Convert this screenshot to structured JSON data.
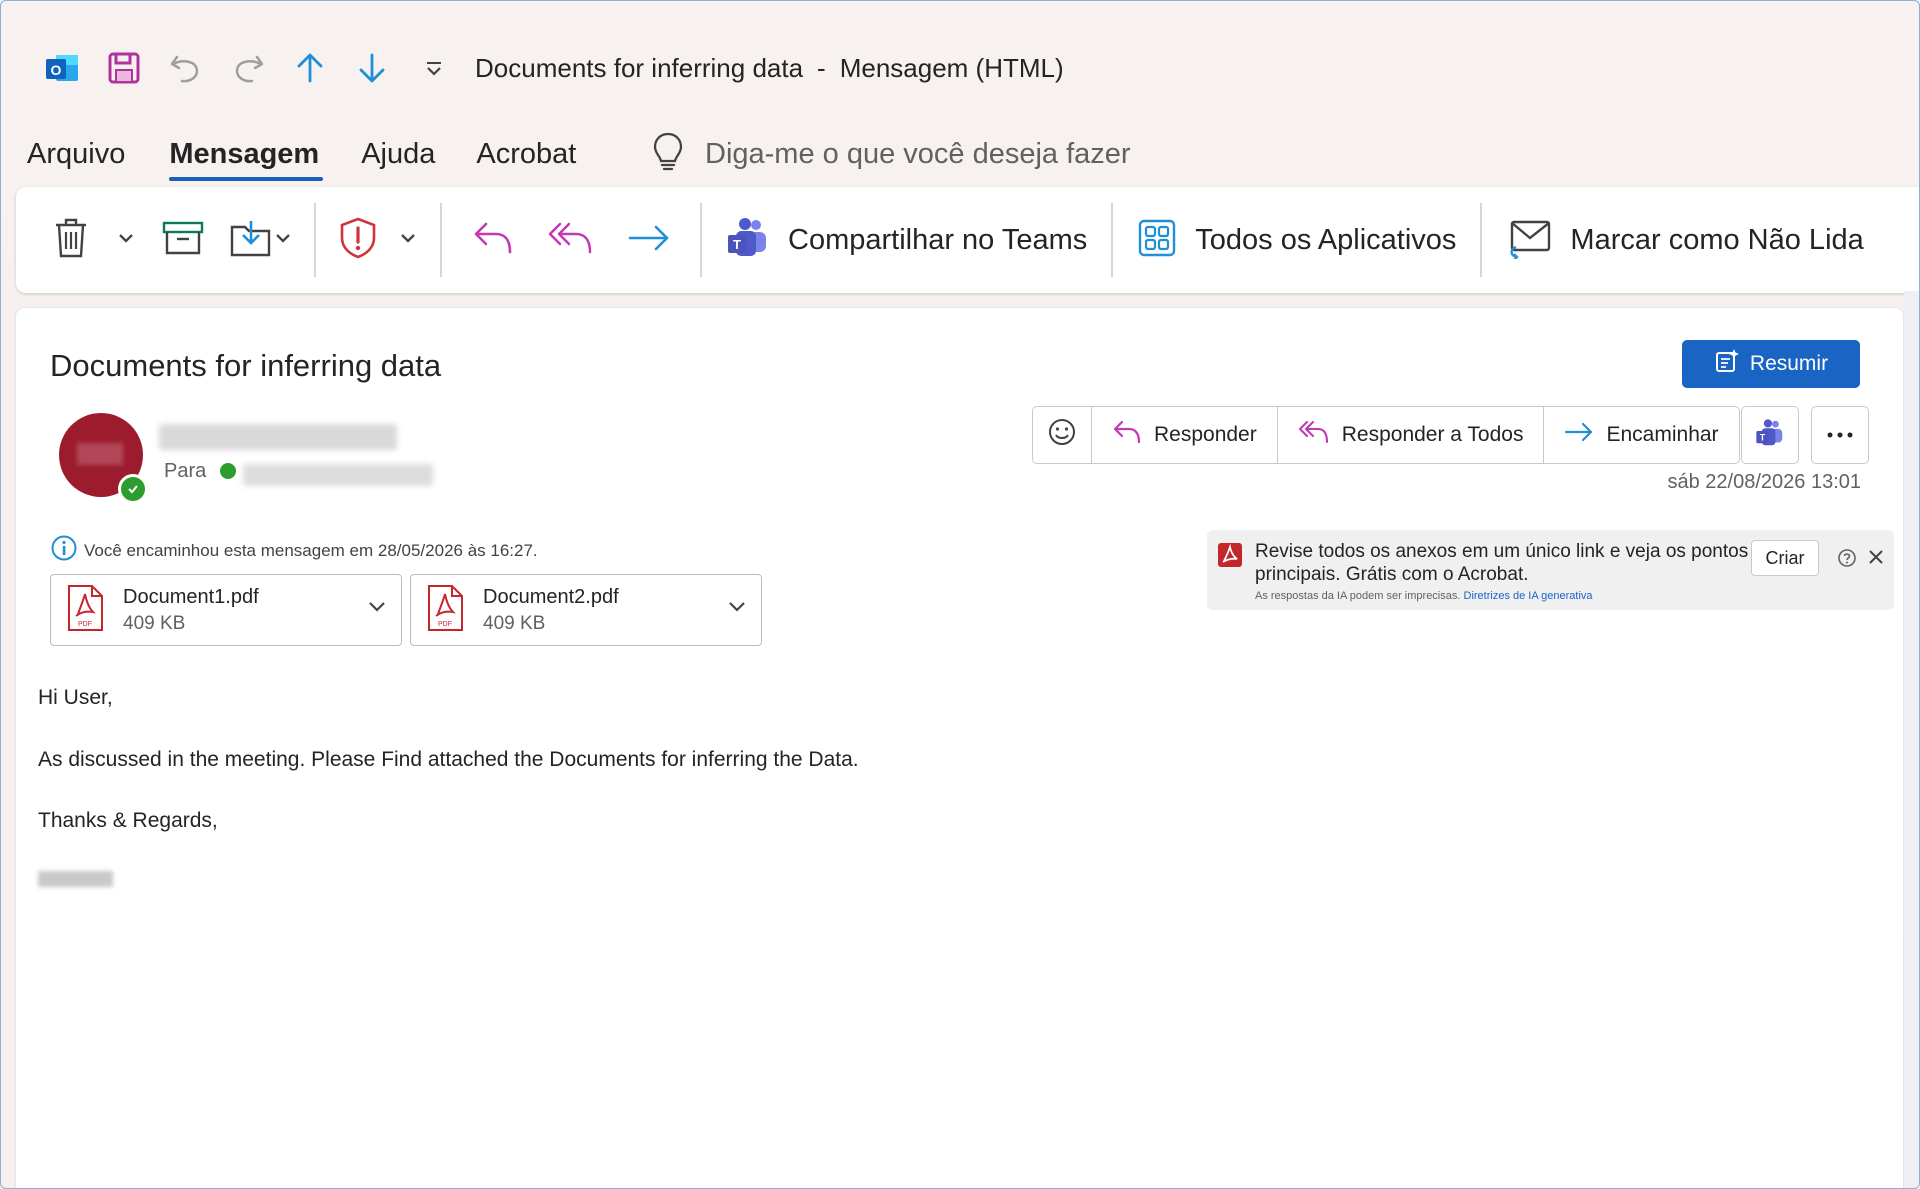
{
  "window": {
    "title": "Documents for inferring data",
    "title_separator": "-",
    "title_suffix": "Mensagem (HTML)"
  },
  "quick_access": {
    "icons": [
      "outlook-logo",
      "save",
      "undo",
      "redo",
      "previous-item",
      "next-item",
      "customize-toolbar"
    ]
  },
  "menu": {
    "tabs": [
      "Arquivo",
      "Mensagem",
      "Ajuda",
      "Acrobat"
    ],
    "active_tab": "Mensagem",
    "tell_me_placeholder": "Diga-me o que você deseja fazer"
  },
  "ribbon": {
    "share_teams_label": "Compartilhar no Teams",
    "all_apps_label": "Todos os Aplicativos",
    "mark_unread_label": "Marcar como Não Lida"
  },
  "message": {
    "subject": "Documents for inferring data",
    "summarize_label": "Resumir",
    "to_label": "Para",
    "datetime": "sáb 22/08/2026 13:01",
    "forward_info": "Você encaminhou esta mensagem em 28/05/2026 às 16:27.",
    "actions": {
      "reply": "Responder",
      "reply_all": "Responder a Todos",
      "forward": "Encaminhar"
    },
    "attachments": [
      {
        "name": "Document1.pdf",
        "size": "409 KB"
      },
      {
        "name": "Document2.pdf",
        "size": "409 KB"
      }
    ],
    "body": {
      "greeting": "Hi User,",
      "paragraph": "As discussed in the meeting. Please Find attached the Documents for inferring the Data.",
      "closing": "Thanks & Regards,"
    }
  },
  "acrobat_banner": {
    "text": "Revise todos os anexos em um único link e veja os pontos principais. Grátis com o Acrobat.",
    "disclaimer": "As respostas da IA podem ser imprecisas.",
    "link_text": "Diretrizes de IA generativa",
    "create_label": "Criar"
  },
  "colors": {
    "accent": "#1a64c4",
    "reply_purple": "#c239b3",
    "forward_blue": "#1f8fd6",
    "avatar_bg": "#9c1c2e",
    "presence_green": "#2d9d2d",
    "pdf_red": "#c4262e"
  }
}
